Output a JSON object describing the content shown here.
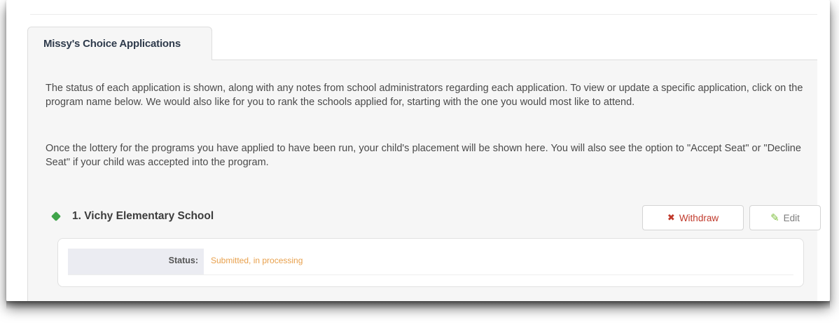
{
  "tab": {
    "label": "Missy's Choice Applications"
  },
  "instructions": {
    "paragraph_1": "The status of each application is shown, along with any notes from school administrators regarding each application. To view or update a specific application, click on the program name below. We would also like for you to rank the schools applied for, starting with the one you would most like to attend.",
    "paragraph_2": "Once the lottery for the programs you have applied to have been run, your child's placement will be shown here. You will also see the option to \"Accept Seat\" or \"Decline Seat\" if your child was accepted into the program."
  },
  "application": {
    "rank_and_name": "1.  Vichy Elementary School",
    "withdraw_label": "Withdraw",
    "edit_label": "Edit",
    "status_label": "Status:",
    "status_value": "Submitted, in processing"
  },
  "icons": {
    "application": "diamond-icon",
    "withdraw": "x-icon",
    "edit": "pencil-icon"
  },
  "colors": {
    "withdraw": "#c0392b",
    "edit_icon": "#7fbf3f",
    "status_value": "#e8a04c",
    "diamond": "#3fa44a"
  }
}
